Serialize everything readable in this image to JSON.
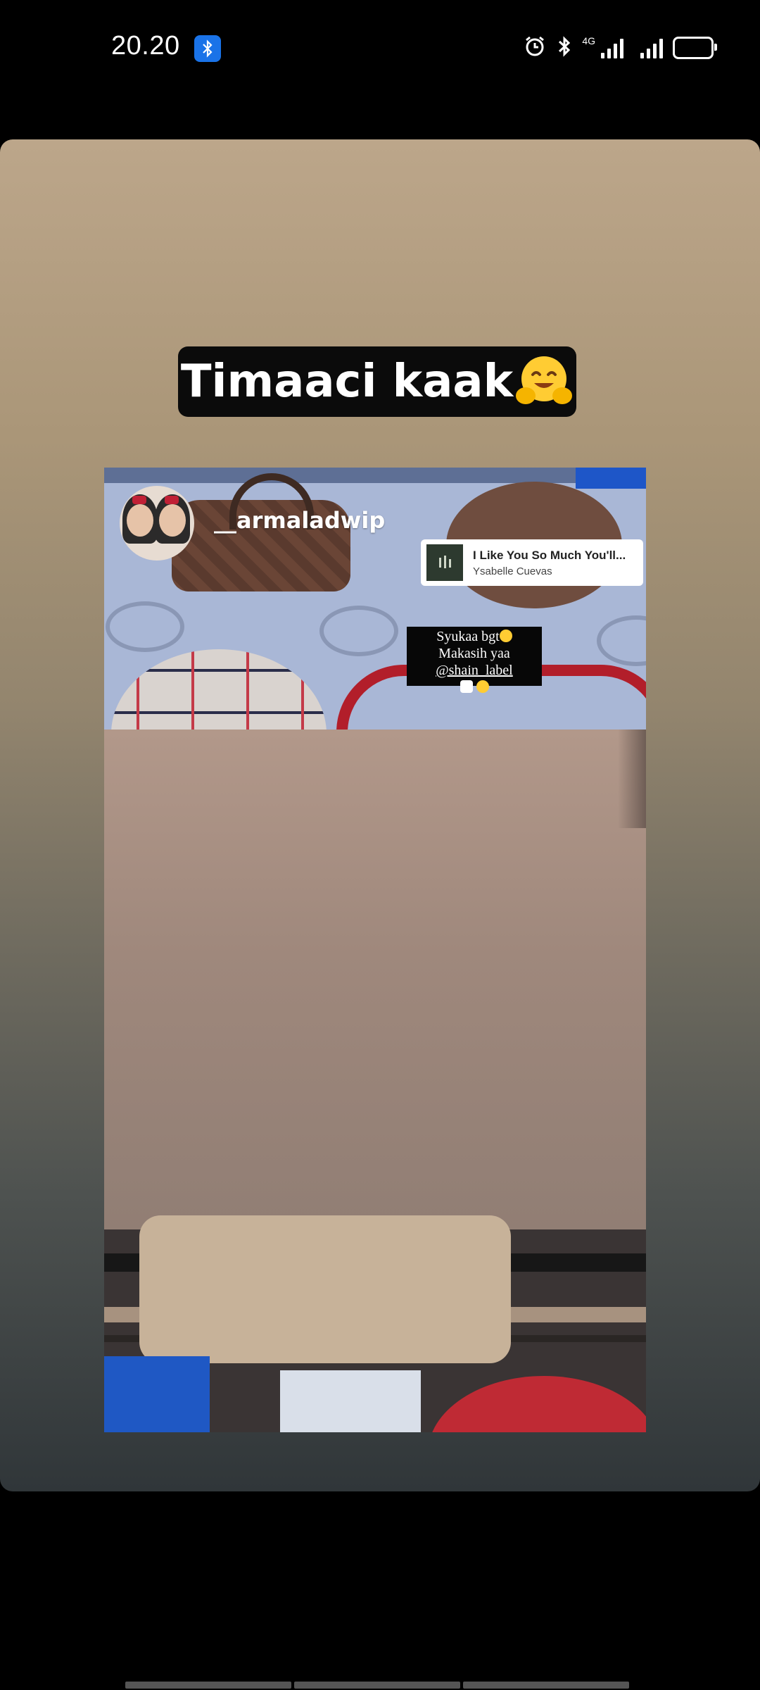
{
  "status_bar": {
    "time": "20.20",
    "network_type": "4G",
    "icons": [
      "bluetooth-notification-icon",
      "alarm-icon",
      "bluetooth-icon",
      "signal-4g-icon",
      "signal-icon",
      "battery-icon"
    ]
  },
  "story": {
    "caption": "Timaaci kaak",
    "caption_emoji": "hugging-face-emoji",
    "repost": {
      "username": "__armaladwip",
      "music_title": "I Like You So Much You'll...",
      "music_artist": "Ysabelle Cuevas",
      "text_line1": "Syukaa bgt",
      "text_line2_prefix": "Makasih yaa ",
      "text_mention": "@shain_label"
    },
    "progress_segments": 3
  },
  "colors": {
    "background": "#000000",
    "caption_bg": "#0b0b0b",
    "bt_notification": "#1a73e8"
  }
}
